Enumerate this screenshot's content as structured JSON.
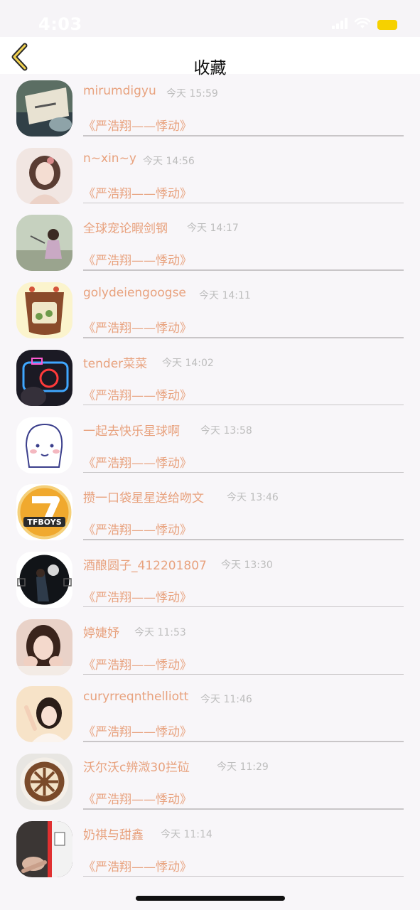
{
  "status_bar": {
    "time": "4:03"
  },
  "header": {
    "title": "收藏"
  },
  "items": [
    {
      "username": "mirumdigyu",
      "time": "今天 15:59",
      "song": "《严浩翔——悸动》"
    },
    {
      "username": "n~xin~y",
      "time": "今天 14:56",
      "song": "《严浩翔——悸动》"
    },
    {
      "username": "全球宠论暇剑钢",
      "time": "今天 14:17",
      "song": "《严浩翔——悸动》"
    },
    {
      "username": "golydeiengoogse",
      "time": "今天 14:11",
      "song": "《严浩翔——悸动》"
    },
    {
      "username": "tender菜菜",
      "time": "今天 14:02",
      "song": "《严浩翔——悸动》"
    },
    {
      "username": "一起去快乐星球啊",
      "time": "今天 13:58",
      "song": "《严浩翔——悸动》"
    },
    {
      "username": "攒一口袋星星送给吻文",
      "time": "今天 13:46",
      "song": "《严浩翔——悸动》"
    },
    {
      "username": "酒酿圆子_412201807",
      "time": "今天 13:30",
      "song": "《严浩翔——悸动》"
    },
    {
      "username": "婷婕妤",
      "time": "今天 11:53",
      "song": "《严浩翔——悸动》"
    },
    {
      "username": "curyrreqnthelliott",
      "time": "今天 11:46",
      "song": "《严浩翔——悸动》"
    },
    {
      "username": "沃尔沃c辨溦30拦砬",
      "time": "今天 11:29",
      "song": "《严浩翔——悸动》"
    },
    {
      "username": "奶祺与甜鑫",
      "time": "今天 11:14",
      "song": "《严浩翔——悸动》"
    }
  ],
  "avatar_logo_text": "TFBOYS"
}
